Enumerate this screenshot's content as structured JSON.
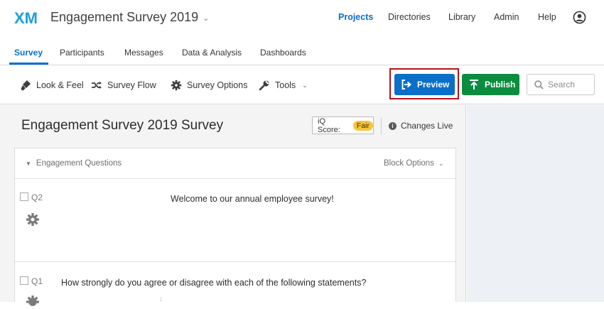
{
  "header": {
    "logo_text": "XM",
    "survey_title": "Engagement Survey 2019",
    "nav": [
      "Projects",
      "Directories",
      "Library",
      "Admin",
      "Help"
    ],
    "active_nav": "Projects"
  },
  "subnav": {
    "tabs": [
      "Survey",
      "Participants",
      "Messages",
      "Data & Analysis",
      "Dashboards"
    ],
    "active_tab": "Survey"
  },
  "toolbar": {
    "look_feel": "Look & Feel",
    "survey_flow": "Survey Flow",
    "survey_options": "Survey Options",
    "tools": "Tools",
    "preview_label": "Preview",
    "publish_label": "Publish",
    "search_placeholder": "Search"
  },
  "editor": {
    "title": "Engagement Survey 2019 Survey",
    "iq_score_label": "iQ Score:",
    "iq_score_value": "Fair",
    "changes_live": "Changes Live"
  },
  "block": {
    "name": "Engagement Questions",
    "options_label": "Block Options",
    "questions": [
      {
        "id": "Q2",
        "text": "Welcome to our annual employee survey!"
      },
      {
        "id": "Q1",
        "text": "How strongly do you agree or disagree with each of the following statements?"
      }
    ]
  },
  "colors": {
    "brand_blue": "#0a6fc8",
    "publish_green": "#0c8c3f",
    "highlight_red": "#b5121b",
    "fair_badge": "#f6c53a"
  }
}
